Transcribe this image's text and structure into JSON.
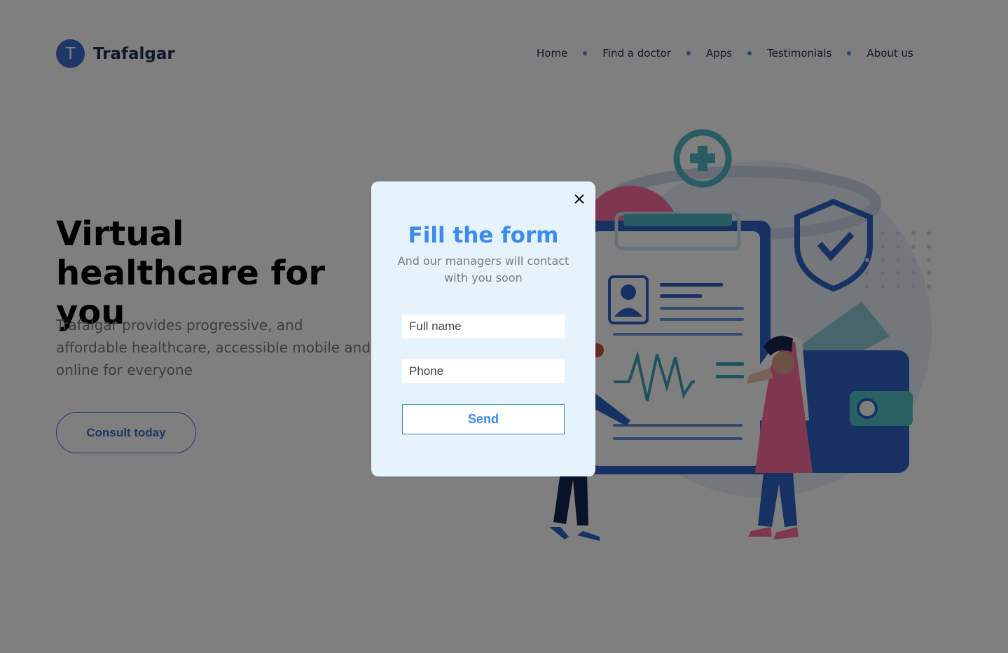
{
  "brand": {
    "initial": "T",
    "name": "Trafalgar",
    "color": "#3d6fd1"
  },
  "nav": {
    "items": [
      {
        "label": "Home"
      },
      {
        "label": "Find a doctor"
      },
      {
        "label": "Apps"
      },
      {
        "label": "Testimonials"
      },
      {
        "label": "About us"
      }
    ]
  },
  "hero": {
    "title": "Virtual healthcare for you",
    "text": "Trafalgar provides progressive, and affordable healthcare, accessible mobile and online for everyone",
    "cta_label": "Consult today"
  },
  "modal": {
    "title": "Fill the form",
    "subtitle": "And our managers will contact with you soon",
    "fullname_placeholder": "Full name",
    "phone_placeholder": "Phone",
    "send_label": "Send",
    "close_icon": "close-icon",
    "title_color": "#3a8af0",
    "background": "#e6f3fc"
  }
}
